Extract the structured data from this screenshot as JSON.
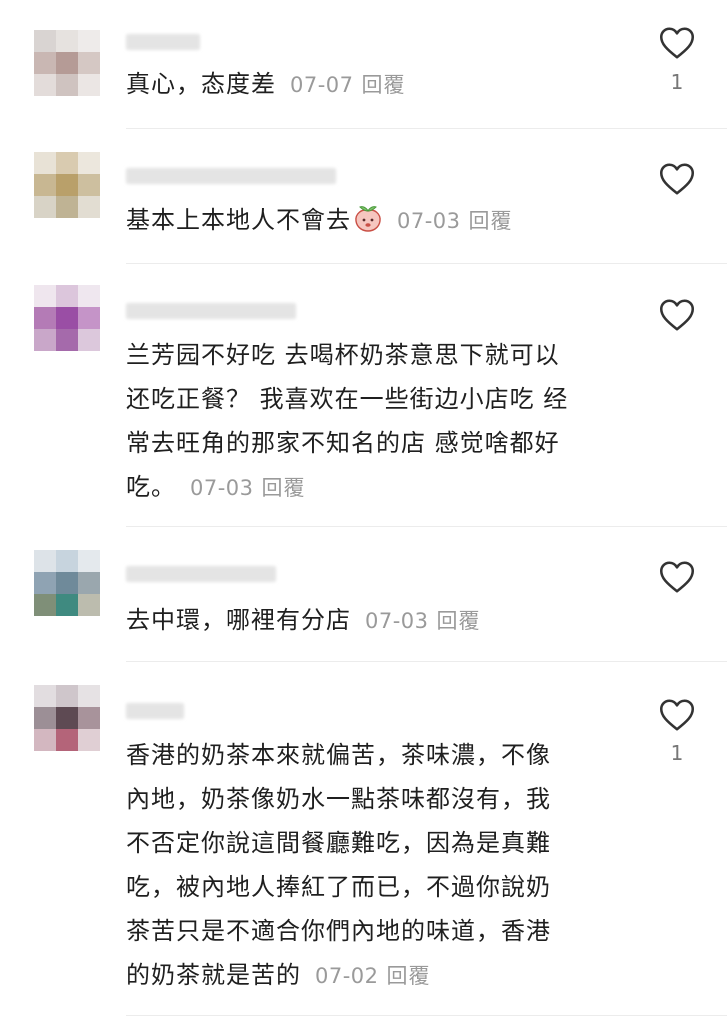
{
  "comments": [
    {
      "text": "真心，态度差",
      "date": "07-07",
      "reply": "回覆",
      "likes": "1"
    },
    {
      "text": "基本上本地人不會去",
      "date": "07-03",
      "reply": "回覆",
      "likes": ""
    },
    {
      "lines": [
        "兰芳园不好吃  去喝杯奶茶意思下就可以",
        "还吃正餐？ 我喜欢在一些街边小店吃 经",
        "常去旺角的那家不知名的店 感觉啥都好",
        "吃。"
      ],
      "date": "07-03",
      "reply": "回覆",
      "likes": ""
    },
    {
      "text": "去中環，哪裡有分店",
      "date": "07-03",
      "reply": "回覆",
      "likes": ""
    },
    {
      "lines": [
        "香港的奶茶本來就偏苦，茶味濃，不像",
        "內地，奶茶像奶水一點茶味都沒有，我",
        "不否定你說這間餐廳難吃，因為是真難",
        "吃，被內地人捧紅了而已，不過你說奶",
        "茶苦只是不適合你們內地的味道，香港",
        "的奶茶就是苦的"
      ],
      "date": "07-02",
      "reply": "回覆",
      "likes": "1"
    }
  ],
  "icons": {
    "like": "heart-outline-icon",
    "emoji": "peach-emoji-icon"
  },
  "colors": {
    "meta": "#9a9a9a",
    "divider": "#ececec"
  }
}
